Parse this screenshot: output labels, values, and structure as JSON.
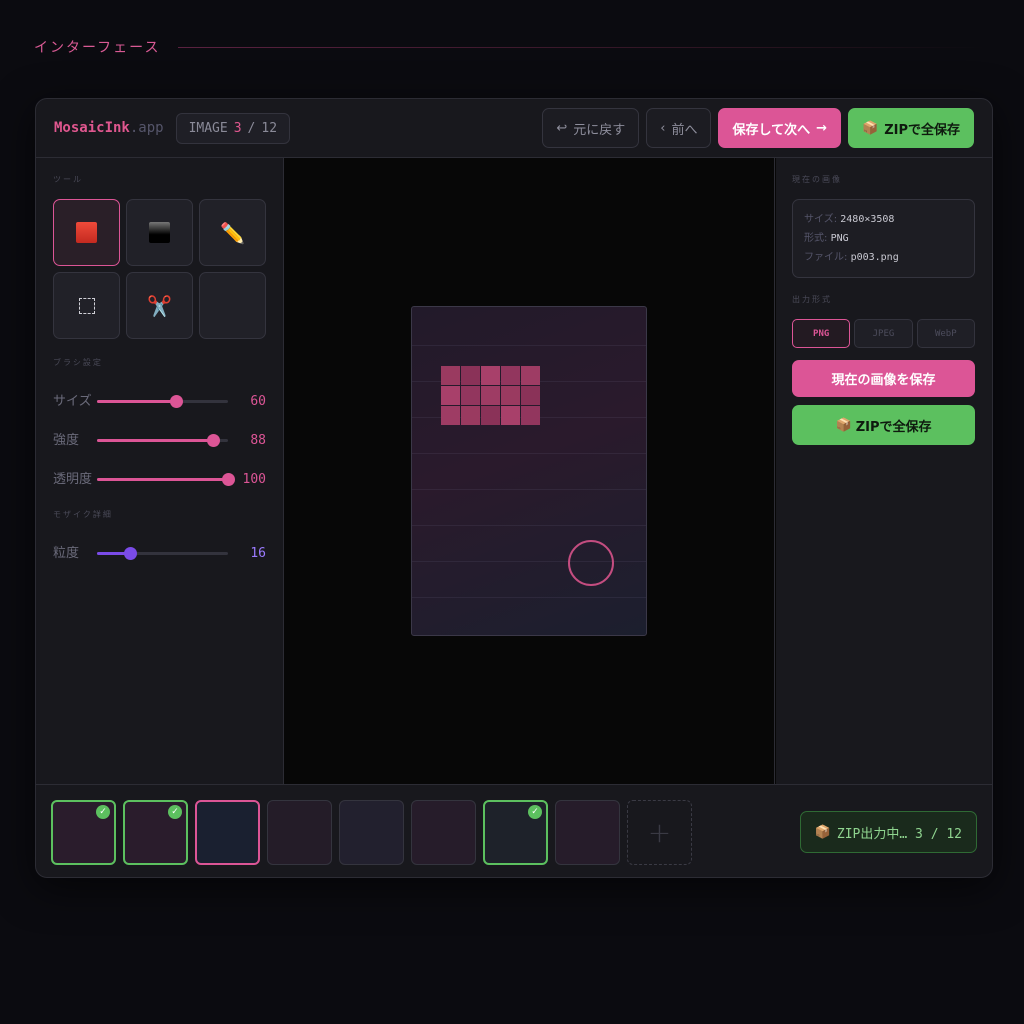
{
  "page": {
    "heading": "インターフェース"
  },
  "header": {
    "brand_name": "MosaicInk",
    "brand_tld": ".app",
    "counter_prefix": "IMAGE",
    "counter_current": "3",
    "counter_sep": "/",
    "counter_total": "12",
    "undo_icon": "↩",
    "undo_label": "元に戻す",
    "prev_icon": "‹",
    "prev_label": "前へ",
    "save_next_label": "保存して次へ",
    "save_next_icon": "→",
    "zip_icon": "📦",
    "zip_label": "ZIPで全保存"
  },
  "left": {
    "tools_label": "ツール",
    "tools": [
      {
        "name": "mosaic-red",
        "icon": "red-square-icon",
        "active": true
      },
      {
        "name": "blackout",
        "icon": "black-square-icon",
        "active": false
      },
      {
        "name": "pencil",
        "icon": "pencil-icon",
        "glyph": "✏️",
        "active": false
      },
      {
        "name": "select",
        "icon": "dashed-selection-icon",
        "active": false
      },
      {
        "name": "cut",
        "icon": "scissors-icon",
        "glyph": "✂️",
        "active": false
      },
      {
        "name": "empty",
        "icon": "",
        "active": false
      }
    ],
    "brush_label": "ブラシ設定",
    "brush": [
      {
        "label": "サイズ",
        "value": 60,
        "display": "60",
        "max": 100
      },
      {
        "label": "強度",
        "value": 88,
        "display": "88",
        "max": 100
      },
      {
        "label": "透明度",
        "value": 100,
        "display": "100",
        "max": 100
      }
    ],
    "mosaic_label": "モザイク詳細",
    "mosaic": [
      {
        "label": "粒度",
        "value": 16,
        "display": "16",
        "max": 64
      }
    ]
  },
  "canvas": {
    "mosaic_colors": [
      "#9a3a60",
      "#8a3258",
      "#a8406a",
      "#92365e",
      "#9e3c64"
    ]
  },
  "right": {
    "current_label": "現在の画像",
    "size_key": "サイズ:",
    "size_val": "2480×3508",
    "format_key": "形式:",
    "format_val": "PNG",
    "file_key": "ファイル:",
    "file_val": "p003.png",
    "output_label": "出力形式",
    "formats": [
      {
        "label": "PNG",
        "active": true
      },
      {
        "label": "JPEG",
        "active": false
      },
      {
        "label": "WebP",
        "active": false
      }
    ],
    "save_current_label": "現在の画像を保存",
    "zip_icon": "📦",
    "zip_label": "ZIPで全保存"
  },
  "strip": {
    "thumbs": [
      {
        "state": "done",
        "bg": "#2a1c2c"
      },
      {
        "state": "done",
        "bg": "#2a1c2c"
      },
      {
        "state": "current",
        "bg": "#1a2030"
      },
      {
        "state": "idle",
        "bg": "#241c28"
      },
      {
        "state": "idle",
        "bg": "#22202e"
      },
      {
        "state": "idle",
        "bg": "#261c2a"
      },
      {
        "state": "done",
        "bg": "#1e222a"
      },
      {
        "state": "idle",
        "bg": "#261c2a"
      }
    ],
    "check_glyph": "✓",
    "add_glyph": "+",
    "zip_icon": "📦",
    "zip_status": "ZIP出力中… 3 / 12"
  },
  "colors": {
    "accent": "#dc5596",
    "success": "#5cc05f",
    "granularity": "#7a4be8"
  }
}
